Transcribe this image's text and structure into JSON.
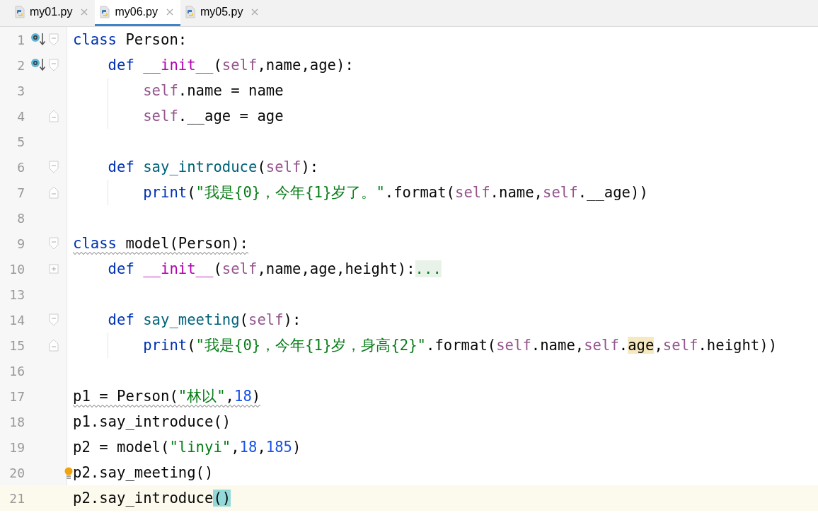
{
  "tabs": [
    {
      "label": "my01.py",
      "selected": false
    },
    {
      "label": "my06.py",
      "selected": true
    },
    {
      "label": "my05.py",
      "selected": false
    }
  ],
  "lines": [
    {
      "number": "1",
      "marker": true,
      "fold_start": true,
      "tokens": [
        {
          "kind": "keyword",
          "text": "class"
        },
        {
          "kind": "plain",
          "text": " Person:"
        }
      ]
    },
    {
      "number": "2",
      "marker": true,
      "fold_start": true,
      "tokens": [
        {
          "kind": "keyword",
          "text": "    def"
        },
        {
          "kind": "magic",
          "text": " __init__"
        },
        {
          "kind": "plain",
          "text": "("
        },
        {
          "kind": "self",
          "text": "self"
        },
        {
          "kind": "plain",
          "text": ",name,age):"
        }
      ]
    },
    {
      "number": "3",
      "guide": true,
      "tokens": [
        {
          "kind": "self",
          "text": "        self"
        },
        {
          "kind": "plain",
          "text": ".name = name"
        }
      ]
    },
    {
      "number": "4",
      "fold_end": true,
      "guide": true,
      "tokens": [
        {
          "kind": "self",
          "text": "        self"
        },
        {
          "kind": "plain",
          "text": ".__age = age"
        }
      ]
    },
    {
      "number": "5"
    },
    {
      "number": "6",
      "fold_start": true,
      "tokens": [
        {
          "kind": "keyword",
          "text": "    def"
        },
        {
          "kind": "function",
          "text": " say_introduce"
        },
        {
          "kind": "plain",
          "text": "("
        },
        {
          "kind": "self",
          "text": "self"
        },
        {
          "kind": "plain",
          "text": "):"
        }
      ]
    },
    {
      "number": "7",
      "fold_end": true,
      "guide": true,
      "tokens": [
        {
          "kind": "builtin",
          "text": "        print"
        },
        {
          "kind": "plain",
          "text": "("
        },
        {
          "kind": "string",
          "text": "\"我是{0}，今年{1}岁了。\""
        },
        {
          "kind": "plain",
          "text": ".format("
        },
        {
          "kind": "self",
          "text": "self"
        },
        {
          "kind": "plain",
          "text": ".name,"
        },
        {
          "kind": "self",
          "text": "self"
        },
        {
          "kind": "plain",
          "text": ".__age))"
        }
      ]
    },
    {
      "number": "8"
    },
    {
      "number": "9",
      "fold_start": true,
      "warning": true,
      "tokens": [
        {
          "kind": "keyword",
          "text": "class"
        },
        {
          "kind": "plain",
          "text": " model(Person):"
        }
      ]
    },
    {
      "number": "10",
      "collapsed": true,
      "tokens": [
        {
          "kind": "keyword",
          "text": "    def"
        },
        {
          "kind": "magic",
          "text": " __init__"
        },
        {
          "kind": "plain",
          "text": "("
        },
        {
          "kind": "self",
          "text": "self"
        },
        {
          "kind": "plain",
          "text": ",name,age,height):"
        },
        {
          "kind": "folded",
          "text": "..."
        }
      ]
    },
    {
      "number": "13"
    },
    {
      "number": "14",
      "fold_start": true,
      "tokens": [
        {
          "kind": "keyword",
          "text": "    def"
        },
        {
          "kind": "function",
          "text": " say_meeting"
        },
        {
          "kind": "plain",
          "text": "("
        },
        {
          "kind": "self",
          "text": "self"
        },
        {
          "kind": "plain",
          "text": "):"
        }
      ]
    },
    {
      "number": "15",
      "fold_end": true,
      "guide": true,
      "tokens": [
        {
          "kind": "builtin",
          "text": "        print"
        },
        {
          "kind": "plain",
          "text": "("
        },
        {
          "kind": "string",
          "text": "\"我是{0}，今年{1}岁，身高{2}\""
        },
        {
          "kind": "plain",
          "text": ".format("
        },
        {
          "kind": "self",
          "text": "self"
        },
        {
          "kind": "plain",
          "text": ".name,"
        },
        {
          "kind": "self",
          "text": "self"
        },
        {
          "kind": "plain",
          "text": "."
        },
        {
          "kind": "usage",
          "text": "age"
        },
        {
          "kind": "plain",
          "text": ","
        },
        {
          "kind": "self",
          "text": "self"
        },
        {
          "kind": "plain",
          "text": ".height))"
        }
      ]
    },
    {
      "number": "16"
    },
    {
      "number": "17",
      "warning": true,
      "tokens": [
        {
          "kind": "plain",
          "text": "p1 = Person("
        },
        {
          "kind": "string",
          "text": "\"林以\""
        },
        {
          "kind": "plain",
          "text": ","
        },
        {
          "kind": "number",
          "text": "18"
        },
        {
          "kind": "plain",
          "text": ")"
        }
      ]
    },
    {
      "number": "18",
      "tokens": [
        {
          "kind": "plain",
          "text": "p1.say_introduce()"
        }
      ]
    },
    {
      "number": "19",
      "tokens": [
        {
          "kind": "plain",
          "text": "p2 = model("
        },
        {
          "kind": "string",
          "text": "\"linyi\""
        },
        {
          "kind": "plain",
          "text": ","
        },
        {
          "kind": "number",
          "text": "18"
        },
        {
          "kind": "plain",
          "text": ","
        },
        {
          "kind": "number",
          "text": "185"
        },
        {
          "kind": "plain",
          "text": ")"
        }
      ]
    },
    {
      "number": "20",
      "bulb": true,
      "tokens": [
        {
          "kind": "plain",
          "text": "p2.say_meeting()"
        }
      ]
    },
    {
      "number": "21",
      "current": true,
      "tokens": [
        {
          "kind": "plain",
          "text": "p2.say_introduce"
        },
        {
          "kind": "brace",
          "text": "()"
        }
      ]
    }
  ]
}
